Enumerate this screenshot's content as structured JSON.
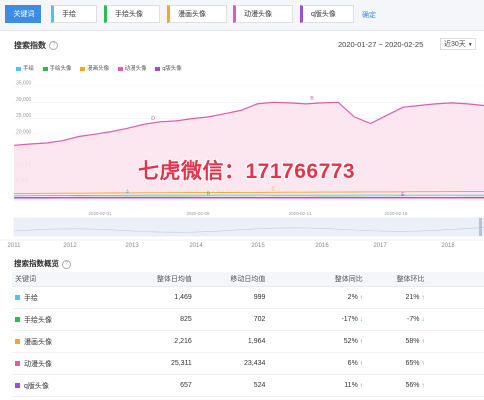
{
  "keywords": {
    "active_label": "关键词",
    "items": [
      {
        "label": "手绘",
        "color": "#4fc3f7"
      },
      {
        "label": "手绘头像",
        "color": "#2bbd4e"
      },
      {
        "label": "漫画头像",
        "color": "#f5a623"
      },
      {
        "label": "动漫头像",
        "color": "#e659a8"
      },
      {
        "label": "q版头像",
        "color": "#9c4fd0"
      }
    ],
    "confirm_label": "确定"
  },
  "trend": {
    "title": "搜索指数",
    "date_range": "2020-01-27 ~ 2020-02-25",
    "range_select": "近30天"
  },
  "chart_data": {
    "type": "line",
    "title": "搜索指数",
    "ylim": [
      0,
      35000
    ],
    "yticks": [
      "35,000",
      "30,000",
      "25,000",
      "20,000",
      "15,000",
      "10,000",
      "5,000"
    ],
    "xtick_labels": [
      "2020-02-01",
      "2020-02-06",
      "2020-02-11",
      "2020-02-16"
    ],
    "grid": true,
    "legend": "top-left",
    "series": [
      {
        "name": "手绘",
        "color": "#4fc3f7",
        "marker": "A",
        "values": [
          1300,
          1320,
          1340,
          1360,
          1380,
          1400,
          1420,
          1440,
          1460,
          1480,
          1460,
          1470,
          1480,
          1490,
          1500,
          1490,
          1480,
          1470,
          1460,
          1470,
          1480,
          1490,
          1500,
          1490,
          1480,
          1470,
          1460,
          1470,
          1480,
          1480
        ]
      },
      {
        "name": "手绘头像",
        "color": "#2bbd4e",
        "marker": "B",
        "values": [
          780,
          790,
          800,
          810,
          820,
          830,
          840,
          850,
          860,
          870,
          860,
          850,
          840,
          830,
          820,
          810,
          820,
          830,
          840,
          850,
          860,
          850,
          840,
          830,
          820,
          810,
          800,
          810,
          820,
          825
        ]
      },
      {
        "name": "漫画头像",
        "color": "#f5a623",
        "marker": "C",
        "values": [
          2000,
          2020,
          2050,
          2080,
          2100,
          2130,
          2150,
          2170,
          2200,
          2220,
          2240,
          2260,
          2280,
          2300,
          2320,
          2340,
          2360,
          2380,
          2400,
          2420,
          2440,
          2460,
          2480,
          2500,
          2520,
          2540,
          2560,
          2580,
          2600,
          2620
        ]
      },
      {
        "name": "动漫头像",
        "color": "#e659a8",
        "marker": "D",
        "values": [
          16800,
          17200,
          17500,
          18200,
          19500,
          20200,
          21000,
          22000,
          23200,
          24000,
          24300,
          25000,
          25500,
          26500,
          27500,
          29500,
          30000,
          29800,
          29500,
          29800,
          30000,
          25500,
          23500,
          26000,
          28500,
          29000,
          29500,
          29800,
          29500,
          29000
        ]
      },
      {
        "name": "q版头像",
        "color": "#9c4fd0",
        "marker": "E",
        "values": [
          600,
          610,
          620,
          630,
          640,
          650,
          660,
          650,
          640,
          630,
          640,
          650,
          660,
          650,
          640,
          630,
          640,
          650,
          660,
          650,
          640,
          650,
          660,
          650,
          640,
          650,
          660,
          650,
          655,
          657
        ]
      }
    ],
    "overview_years": [
      "2011",
      "2012",
      "2013",
      "2014",
      "2015",
      "2016",
      "2017",
      "2018"
    ]
  },
  "watermark": "七虎微信：171766773",
  "table": {
    "title": "搜索指数概览",
    "headers": [
      "关键词",
      "整体日均值",
      "移动日均值",
      "整体同比",
      "整体环比"
    ],
    "rows": [
      {
        "name": "手绘",
        "color": "#4fc3f7",
        "overall": "1,469",
        "mobile": "999",
        "yoy": "2%",
        "yoy_dir": "up",
        "mom": "21%",
        "mom_dir": "up"
      },
      {
        "name": "手绘头像",
        "color": "#2bbd4e",
        "overall": "825",
        "mobile": "702",
        "yoy": "-17%",
        "yoy_dir": "down",
        "mom": "-7%",
        "mom_dir": "down"
      },
      {
        "name": "漫画头像",
        "color": "#f5a623",
        "overall": "2,216",
        "mobile": "1,964",
        "yoy": "52%",
        "yoy_dir": "up",
        "mom": "58%",
        "mom_dir": "up"
      },
      {
        "name": "动漫头像",
        "color": "#e659a8",
        "overall": "25,311",
        "mobile": "23,434",
        "yoy": "6%",
        "yoy_dir": "up",
        "mom": "65%",
        "mom_dir": "up"
      },
      {
        "name": "q版头像",
        "color": "#9c4fd0",
        "overall": "657",
        "mobile": "524",
        "yoy": "11%",
        "yoy_dir": "up",
        "mom": "56%",
        "mom_dir": "up"
      }
    ]
  }
}
